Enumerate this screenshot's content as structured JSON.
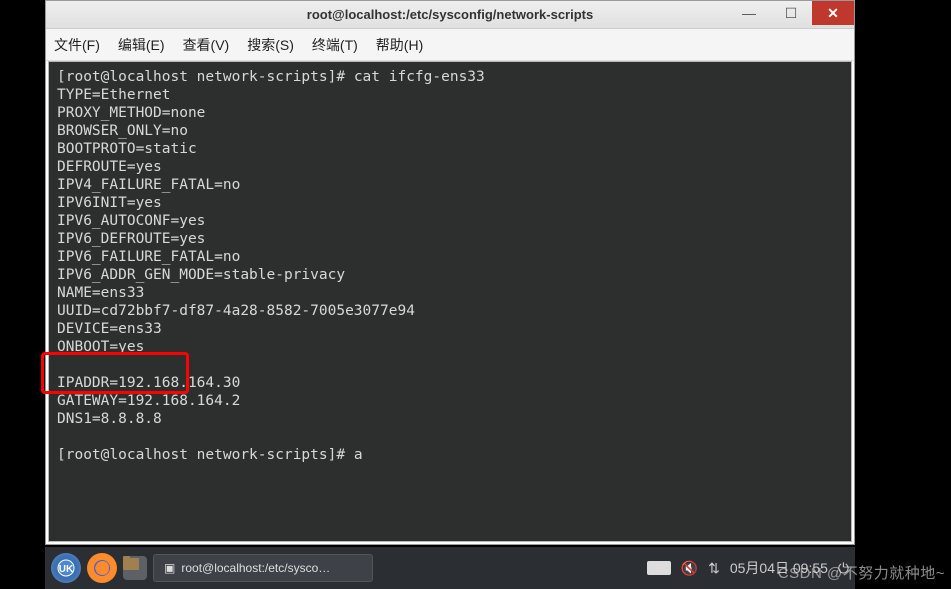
{
  "window": {
    "title": "root@localhost:/etc/sysconfig/network-scripts"
  },
  "menubar": {
    "file": "文件(F)",
    "edit": "编辑(E)",
    "view": "查看(V)",
    "search": "搜索(S)",
    "terminal": "终端(T)",
    "help": "帮助(H)"
  },
  "terminal": {
    "prompt1": "[root@localhost network-scripts]# ",
    "command1": "cat ifcfg-ens33",
    "lines": [
      "TYPE=Ethernet",
      "PROXY_METHOD=none",
      "BROWSER_ONLY=no",
      "BOOTPROTO=static",
      "DEFROUTE=yes",
      "IPV4_FAILURE_FATAL=no",
      "IPV6INIT=yes",
      "IPV6_AUTOCONF=yes",
      "IPV6_DEFROUTE=yes",
      "IPV6_FAILURE_FATAL=no",
      "IPV6_ADDR_GEN_MODE=stable-privacy",
      "NAME=ens33",
      "UUID=cd72bbf7-df87-4a28-8582-7005e3077e94",
      "DEVICE=ens33",
      "ONBOOT=yes",
      "",
      "IPADDR=192.168.164.30",
      "GATEWAY=192.168.164.2",
      "DNS1=8.8.8.8",
      ""
    ],
    "prompt2": "[root@localhost network-scripts]# ",
    "command2": "a"
  },
  "taskbar": {
    "active_task": "root@localhost:/etc/sysco…",
    "datetime": "05月04日 09:55"
  },
  "watermark": "CSDN @不努力就种地~"
}
